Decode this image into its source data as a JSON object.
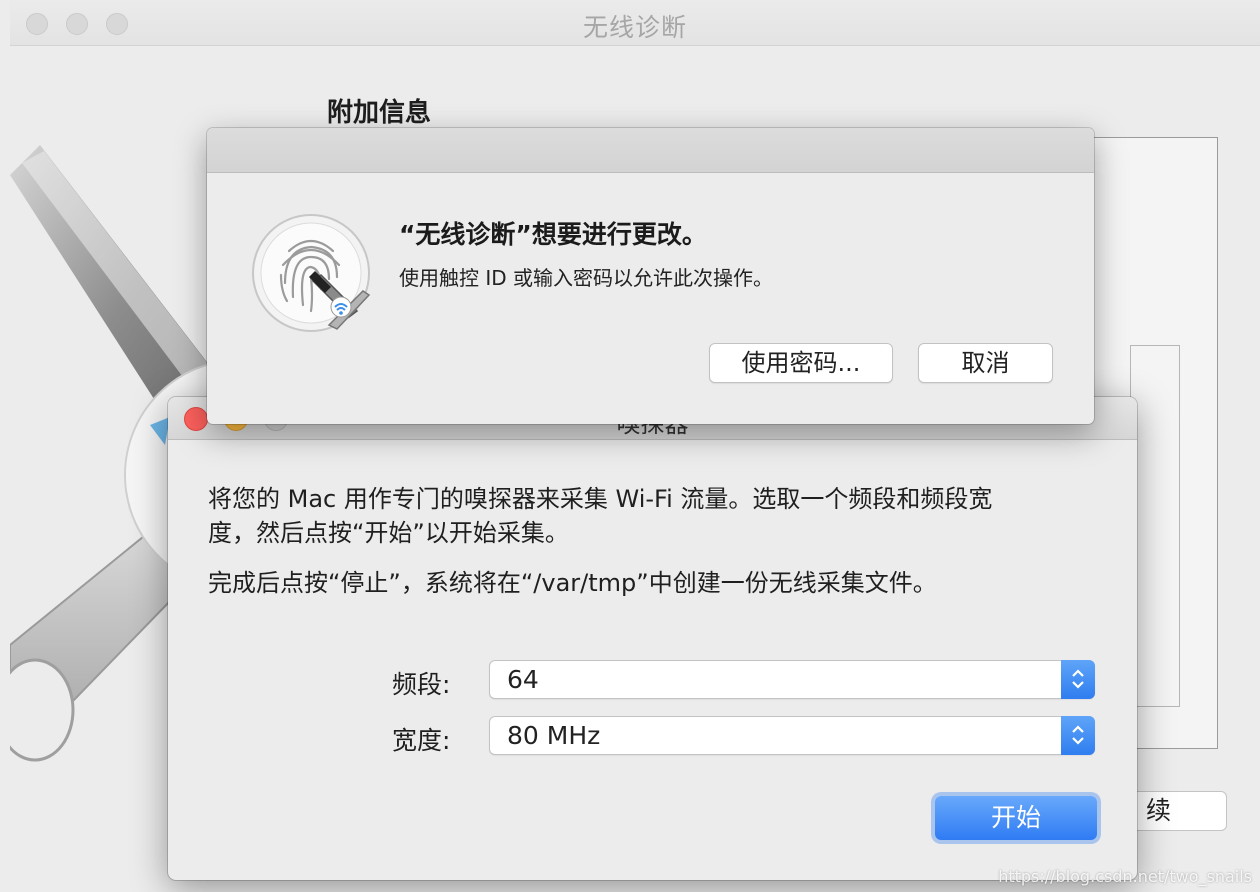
{
  "main_window": {
    "title": "无线诊断",
    "section_title": "附加信息",
    "continue_label": "续"
  },
  "auth_dialog": {
    "title": "“无线诊断”想要进行更改。",
    "message": "使用触控 ID 或输入密码以允许此次操作。",
    "use_password_label": "使用密码...",
    "cancel_label": "取消",
    "icon": "touchid-wrench-icon"
  },
  "sniffer_dialog": {
    "title": "嗅探器",
    "description_line1": "将您的 Mac 用作专门的嗅探器来采集 Wi-Fi 流量。选取一个频段和频段宽",
    "description_line2": "度，然后点按“开始”以开始采集。",
    "description_line3": "完成后点按“停止”，系统将在“/var/tmp”中创建一份无线采集文件。",
    "channel_label": "频段:",
    "channel_value": "64",
    "width_label": "宽度:",
    "width_value": "80 MHz",
    "start_label": "开始"
  },
  "watermark": "https://blog.csdn.net/two_snails",
  "colors": {
    "accent": "#2f7ef0",
    "close": "#fc605c",
    "minimize": "#fdbc40"
  }
}
